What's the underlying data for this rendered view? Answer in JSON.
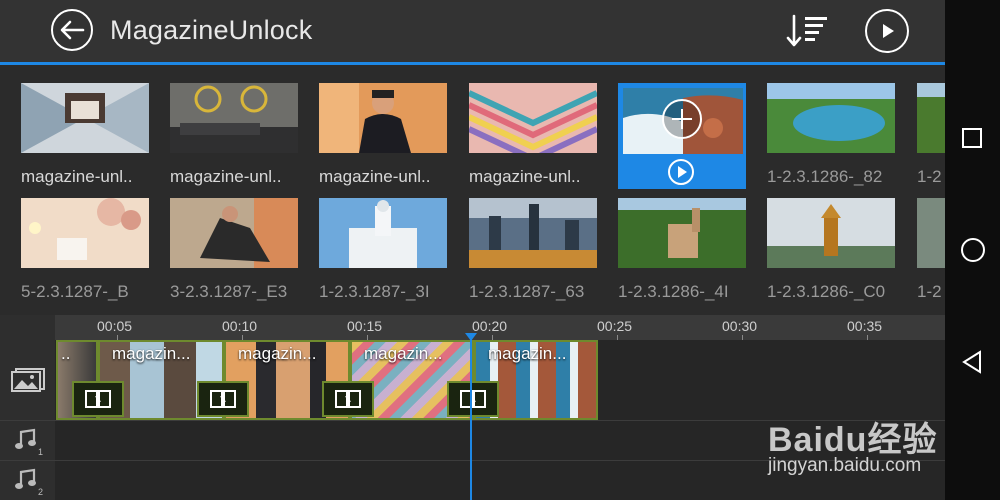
{
  "header": {
    "title": "MagazineUnlock"
  },
  "media_rows": [
    [
      {
        "caption": "magazine-unl..",
        "selected": false
      },
      {
        "caption": "magazine-unl..",
        "selected": false
      },
      {
        "caption": "magazine-unl..",
        "selected": false
      },
      {
        "caption": "magazine-unl..",
        "selected": false
      },
      {
        "caption": "",
        "selected": true
      },
      {
        "caption": "1-2.3.1286-_82",
        "selected": false
      },
      {
        "caption": "1-2",
        "selected": false
      }
    ],
    [
      {
        "caption": "5-2.3.1287-_B",
        "selected": false
      },
      {
        "caption": "3-2.3.1287-_E3",
        "selected": false
      },
      {
        "caption": "1-2.3.1287-_3I",
        "selected": false
      },
      {
        "caption": "1-2.3.1287-_63",
        "selected": false
      },
      {
        "caption": "1-2.3.1286-_4I",
        "selected": false
      },
      {
        "caption": "1-2.3.1286-_C0",
        "selected": false
      },
      {
        "caption": "1-2",
        "selected": false
      }
    ]
  ],
  "timeline": {
    "ticks": [
      "00:05",
      "00:10",
      "00:15",
      "00:20",
      "00:25",
      "00:30",
      "00:35"
    ],
    "clips": [
      {
        "label": "magazin..."
      },
      {
        "label": "magazin..."
      },
      {
        "label": "magazin..."
      },
      {
        "label": "magazin..."
      }
    ],
    "audio_tracks": [
      "1",
      "2"
    ]
  },
  "watermark": {
    "logo": "Baidu经验",
    "url": "jingyan.baidu.com"
  },
  "colors": {
    "accent": "#1e88e5",
    "clip_border": "#6e8a2e",
    "header_bg": "#333333"
  }
}
